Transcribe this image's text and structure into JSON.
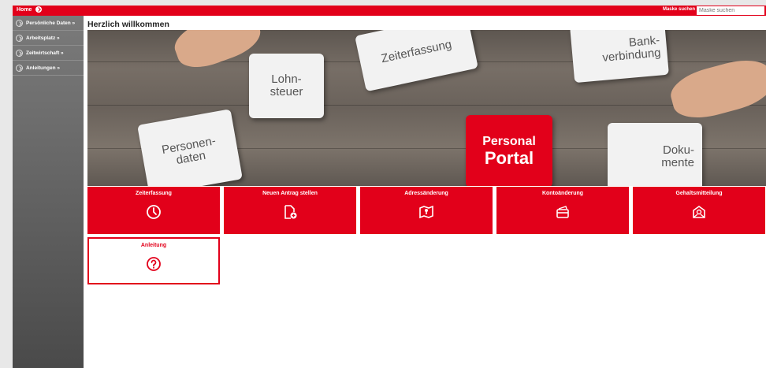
{
  "topbar": {
    "home_label": "Home",
    "mask_label": "Maske suchen",
    "mask_placeholder": "Maske suchen"
  },
  "sidebar": {
    "items": [
      {
        "label": "Persönliche Daten »"
      },
      {
        "label": "Arbeitsplatz »"
      },
      {
        "label": "Zeitwirtschaft »"
      },
      {
        "label": "Anleitungen »"
      }
    ]
  },
  "main": {
    "title": "Herzlich willkommen",
    "banner": {
      "pieces": [
        "Lohn-",
        "steuer",
        "Zeiterfassung",
        "Bank-",
        "verbindung",
        "Personen-",
        "daten",
        "Personal",
        "Portal",
        "Doku-",
        "mente"
      ]
    },
    "tiles": [
      {
        "label": "Zeiterfassung",
        "icon": "clock-icon"
      },
      {
        "label": "Neuen Antrag stellen",
        "icon": "new-document-icon"
      },
      {
        "label": "Adressänderung",
        "icon": "map-pin-icon"
      },
      {
        "label": "Kontoänderung",
        "icon": "credit-card-icon"
      },
      {
        "label": "Gehaltsmitteilung",
        "icon": "salary-envelope-icon"
      },
      {
        "label": "Anleitung",
        "icon": "help-icon"
      }
    ]
  },
  "colors": {
    "brand_red": "#e2001a",
    "sidebar_gray": "#6d6d6d"
  }
}
